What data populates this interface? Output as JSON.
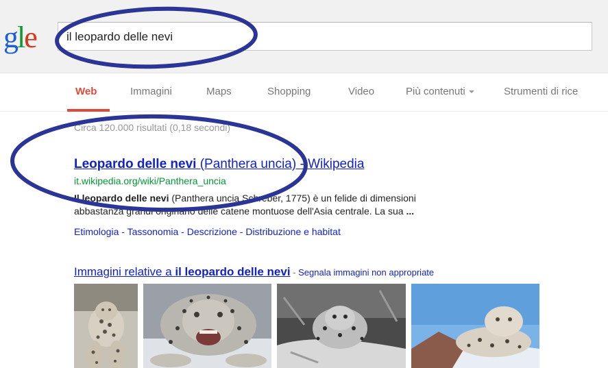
{
  "search": {
    "logo_fragment": "gle",
    "query": "il leopardo delle nevi"
  },
  "nav": {
    "tabs": [
      "Web",
      "Immagini",
      "Maps",
      "Shopping",
      "Video",
      "Più contenuti",
      "Strumenti di rice"
    ],
    "active_tab": "Web"
  },
  "stats": "Circa 120.000 risultati (0,18 secondi)",
  "result": {
    "title_bold": "Leopardo delle nevi",
    "title_rest": " (Panthera uncia) - Wikipedia",
    "url": "it.wikipedia.org/wiki/Panthera_uncia",
    "snippet_bold": "Il leopardo delle nevi",
    "snippet_line1": " (Panthera uncia Schreber, 1775) è un felide di dimensioni",
    "snippet_line2": "abbastanza grandi originario delle catene montuose dell'Asia centrale. La sua ",
    "snippet_ellipsis": "...",
    "sitelinks": [
      "Etimologia",
      "Tassonomia",
      "Descrizione",
      "Distribuzione e habitat"
    ],
    "sitelink_separator": " - "
  },
  "images": {
    "header_prefix": "Immagini relative a ",
    "header_query": "il leopardo delle nevi",
    "header_dash": " - ",
    "report_label": "Segnala immagini non appropriate",
    "thumbnails": [
      "snow-leopard-walking",
      "snow-leopard-snarling",
      "snow-leopard-in-snow-bw",
      "snow-leopard-lying-blue-sky"
    ]
  },
  "colors": {
    "active_tab": "#dd4b39",
    "link": "#1122cc",
    "url": "#009933",
    "annotation_ellipse": "#2b3595"
  }
}
